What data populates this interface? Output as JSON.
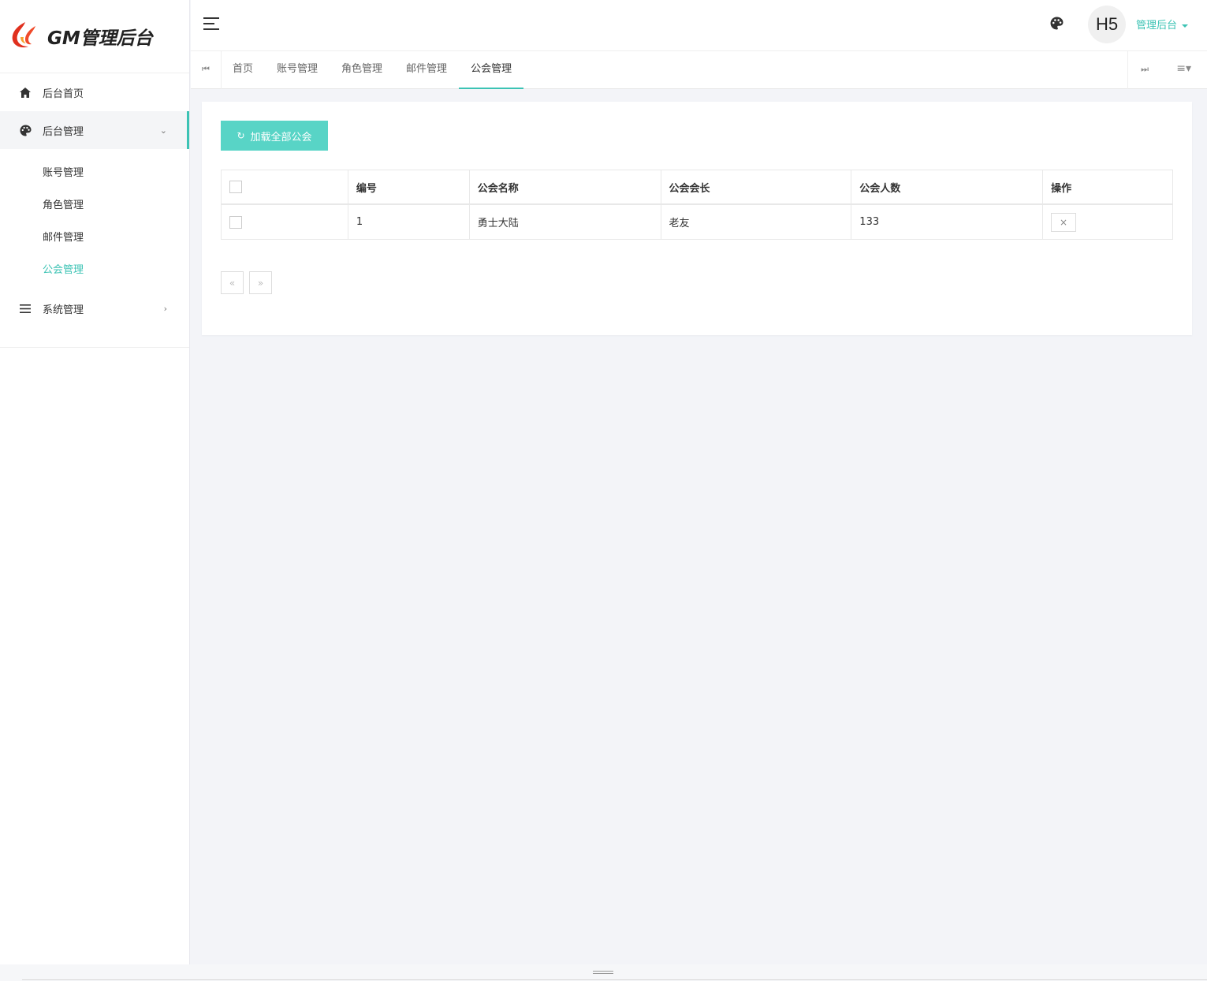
{
  "brand": {
    "logo_text": "GM管理后台"
  },
  "colors": {
    "accent": "#3cc3b4",
    "button": "#58d4c6"
  },
  "sidebar": {
    "items": [
      {
        "label": "后台首页",
        "icon": "home-icon"
      },
      {
        "label": "后台管理",
        "icon": "palette-icon",
        "expanded": true,
        "children": [
          {
            "label": "账号管理"
          },
          {
            "label": "角色管理"
          },
          {
            "label": "邮件管理"
          },
          {
            "label": "公会管理",
            "active": true
          }
        ]
      },
      {
        "label": "系统管理",
        "icon": "list-icon"
      }
    ]
  },
  "header": {
    "avatar_text": "H5",
    "user_menu": "管理后台"
  },
  "tabs": [
    {
      "label": "首页"
    },
    {
      "label": "账号管理"
    },
    {
      "label": "角色管理"
    },
    {
      "label": "邮件管理"
    },
    {
      "label": "公会管理",
      "active": true
    }
  ],
  "toolbar": {
    "load_all_label": "加载全部公会"
  },
  "table": {
    "headers": [
      "编号",
      "公会名称",
      "公会会长",
      "公会人数",
      "操作"
    ],
    "rows": [
      {
        "id": "1",
        "name": "勇士大陆",
        "leader": "老友",
        "members": "133",
        "action": "×"
      }
    ]
  },
  "pager": {
    "prev": "«",
    "next": "»"
  }
}
